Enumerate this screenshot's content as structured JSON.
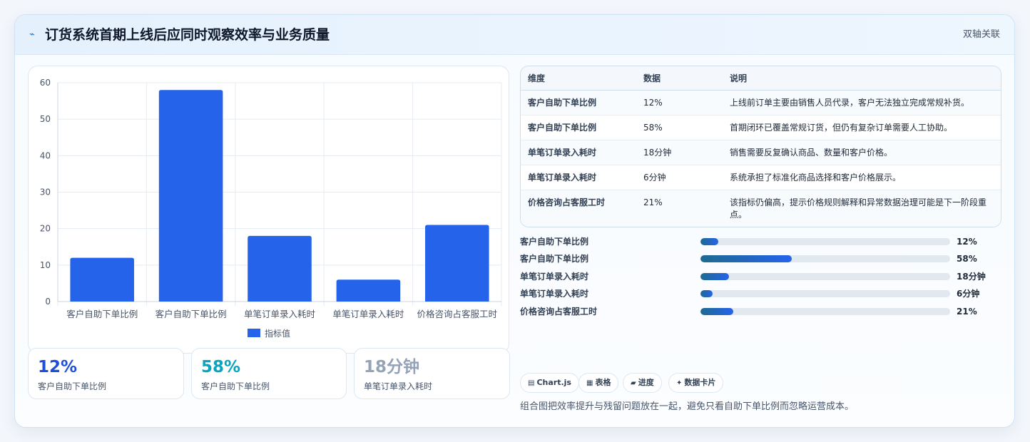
{
  "header": {
    "icon": "trend-line-icon",
    "title": "订货系统首期上线后应同时观察效率与业务质量",
    "tag": "双轴关联"
  },
  "chart_data": {
    "type": "bar",
    "categories": [
      "客户自助下单比例",
      "客户自助下单比例",
      "单笔订单录入耗时",
      "单笔订单录入耗时",
      "价格咨询占客服工时"
    ],
    "series": [
      {
        "name": "指标值",
        "values": [
          12,
          58,
          18,
          6,
          21
        ],
        "color": "#2563eb"
      }
    ],
    "ylim": [
      0,
      60
    ],
    "yticks": [
      0,
      10,
      20,
      30,
      40,
      50,
      60
    ],
    "grid": true,
    "legend": "bottom"
  },
  "kpis": [
    {
      "value": "12%",
      "label": "客户自助下单比例",
      "color": "#1d4ed8"
    },
    {
      "value": "58%",
      "label": "客户自助下单比例",
      "color": "#06a5c0"
    },
    {
      "value": "18分钟",
      "label": "单笔订单录入耗时",
      "color": "#94a3b8"
    }
  ],
  "table": {
    "headers": [
      "维度",
      "数据",
      "说明"
    ],
    "rows": [
      {
        "dimension": "客户自助下单比例",
        "data": "12%",
        "note": "上线前订单主要由销售人员代录，客户无法独立完成常规补货。"
      },
      {
        "dimension": "客户自助下单比例",
        "data": "58%",
        "note": "首期闭环已覆盖常规订货，但仍有复杂订单需要人工协助。"
      },
      {
        "dimension": "单笔订单录入耗时",
        "data": "18分钟",
        "note": "销售需要反复确认商品、数量和客户价格。"
      },
      {
        "dimension": "单笔订单录入耗时",
        "data": "6分钟",
        "note": "系统承担了标准化商品选择和客户价格展示。"
      },
      {
        "dimension": "价格咨询占客服工时",
        "data": "21%",
        "note_line1": "该指标仍偏高，提示价格规则解释和异常数据治理可能是下一阶段重",
        "note_line2": "点。"
      }
    ]
  },
  "progress": [
    {
      "label": "客户自助下单比例",
      "value": "12%",
      "fraction": 0.07
    },
    {
      "label": "客户自助下单比例",
      "value": "58%",
      "fraction": 0.365
    },
    {
      "label": "单笔订单录入耗时",
      "value": "18分钟",
      "fraction": 0.115
    },
    {
      "label": "单笔订单录入耗时",
      "value": "6分钟",
      "fraction": 0.048
    },
    {
      "label": "价格咨询占客服工时",
      "value": "21%",
      "fraction": 0.132
    }
  ],
  "chips": [
    {
      "icon": "chart-icon",
      "glyph": "▤",
      "label": "Chart.js"
    },
    {
      "icon": "table-icon",
      "glyph": "▦",
      "label": "表格"
    },
    {
      "icon": "progress-icon",
      "glyph": "▰",
      "label": "进度"
    },
    {
      "icon": "card-icon",
      "glyph": "✦",
      "label": "数据卡片"
    }
  ],
  "footer_note": "组合图把效率提升与残留问题放在一起，避免只看自助下单比例而忽略运营成本。"
}
